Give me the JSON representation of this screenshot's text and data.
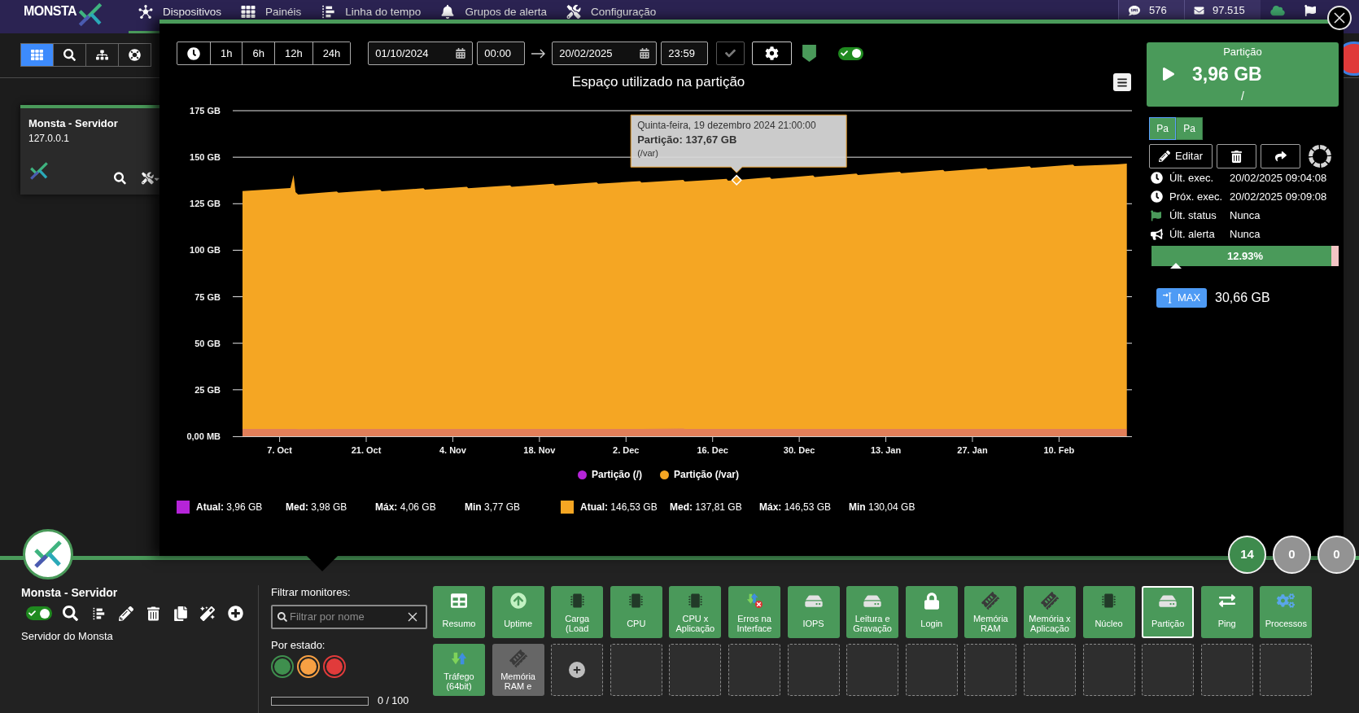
{
  "nav": {
    "logo": "MONSTA",
    "items": [
      {
        "label": "Dispositivos",
        "selected": true
      },
      {
        "label": "Painéis",
        "selected": false
      },
      {
        "label": "Linha do tempo",
        "selected": false
      },
      {
        "label": "Grupos de alerta",
        "selected": false
      },
      {
        "label": "Configuração",
        "selected": false
      }
    ],
    "counters": [
      {
        "kind": "sms",
        "value": "576"
      },
      {
        "kind": "mail",
        "value": "97.515"
      }
    ]
  },
  "view_buttons": [
    {
      "selected": true
    },
    {
      "selected": false
    },
    {
      "selected": false
    },
    {
      "selected": false
    }
  ],
  "device_card": {
    "name": "Monsta - Servidor",
    "address": "127.0.0.1"
  },
  "modal": {
    "toolbar": {
      "presets": [
        {
          "label": "1h",
          "selected": false
        },
        {
          "label": "6h",
          "selected": false
        },
        {
          "label": "12h",
          "selected": false
        },
        {
          "label": "24h",
          "selected": false
        }
      ],
      "start_date": "01/10/2024",
      "start_time": "00:00",
      "end_date": "20/02/2025",
      "end_time": "23:59",
      "apply_disabled": true,
      "live": true
    },
    "chart": {
      "chart_data": {
        "type": "area",
        "title": "Espaço utilizado na partição",
        "grid": true,
        "x": [
          "2024-10-01 00:00",
          "2024-10-08 18:00",
          "2024-10-09 06:00",
          "2024-10-09 14:00",
          "2024-10-10 00:00",
          "2024-10-16 06:00",
          "2024-10-16 12:00",
          "2024-10-23 06:00",
          "2024-10-23 12:00",
          "2024-10-30 06:00",
          "2024-10-30 12:00",
          "2024-11-06 06:00",
          "2024-11-06 12:00",
          "2024-11-13 06:00",
          "2024-11-13 12:00",
          "2024-11-20 06:00",
          "2024-11-20 12:00",
          "2024-11-27 06:00",
          "2024-11-27 12:00",
          "2024-12-04 06:00",
          "2024-12-04 12:00",
          "2024-12-11 06:00",
          "2024-12-11 12:00",
          "2024-12-18 06:00",
          "2024-12-18 12:00",
          "2024-12-19 21:00",
          "2024-12-25 06:00",
          "2024-12-25 12:00",
          "2025-01-01 06:00",
          "2025-01-01 12:00",
          "2025-01-08 06:00",
          "2025-01-08 12:00",
          "2025-01-15 06:00",
          "2025-01-15 12:00",
          "2025-01-22 06:00",
          "2025-01-22 12:00",
          "2025-01-29 06:00",
          "2025-01-29 12:00",
          "2025-02-05 06:00",
          "2025-02-05 12:00",
          "2025-02-12 06:00",
          "2025-02-12 12:00",
          "2025-02-19 06:00",
          "2025-02-20 23:00"
        ],
        "series": [
          {
            "name": "Partição (/)",
            "color": "#b524d8",
            "values": [
              3.9,
              4.0,
              4.0,
              3.9,
              3.8,
              3.9,
              3.9,
              4.0,
              4.0,
              4.0,
              4.0,
              4.0,
              4.0,
              4.0,
              4.0,
              4.0,
              4.0,
              4.0,
              4.0,
              4.0,
              4.0,
              4.1,
              4.0,
              4.0,
              4.0,
              4.0,
              4.0,
              4.0,
              4.0,
              4.0,
              4.0,
              4.0,
              4.0,
              4.0,
              4.0,
              4.0,
              4.0,
              4.0,
              4.0,
              4.0,
              4.0,
              4.0,
              4.0,
              4.0
            ]
          },
          {
            "name": "Partição (/var)",
            "color": "#f5a623",
            "values": [
              131.8,
              133.4,
              140.4,
              131.2,
              130.0,
              131.6,
              130.9,
              132.5,
              131.7,
              133.3,
              132.5,
              134.1,
              133.3,
              134.9,
              134.1,
              135.7,
              134.9,
              136.5,
              135.7,
              137.2,
              136.4,
              137.8,
              137.0,
              138.4,
              137.4,
              137.7,
              139.2,
              138.4,
              140.2,
              139.4,
              141.2,
              140.4,
              142.2,
              141.4,
              143.2,
              142.4,
              144.2,
              143.4,
              145.1,
              144.3,
              146.0,
              145.2,
              146.1,
              146.5
            ]
          }
        ],
        "xlim": [
          "2024-10-01 00:00",
          "2025-02-20 23:59"
        ],
        "ylim": [
          0,
          175
        ],
        "xticks": [
          {
            "value": "2024-10-07 00:00",
            "label": "7. Oct"
          },
          {
            "value": "2024-10-21 00:00",
            "label": "21. Oct"
          },
          {
            "value": "2024-11-04 00:00",
            "label": "4. Nov"
          },
          {
            "value": "2024-11-18 00:00",
            "label": "18. Nov"
          },
          {
            "value": "2024-12-02 00:00",
            "label": "2. Dec"
          },
          {
            "value": "2024-12-16 00:00",
            "label": "16. Dec"
          },
          {
            "value": "2024-12-30 00:00",
            "label": "30. Dec"
          },
          {
            "value": "2025-01-13 00:00",
            "label": "13. Jan"
          },
          {
            "value": "2025-01-27 00:00",
            "label": "27. Jan"
          },
          {
            "value": "2025-02-10 00:00",
            "label": "10. Feb"
          }
        ],
        "yticks": [
          {
            "value": 0,
            "label": "0,00 MB"
          },
          {
            "value": 25,
            "label": "25 GB"
          },
          {
            "value": 50,
            "label": "50 GB"
          },
          {
            "value": 75,
            "label": "75 GB"
          },
          {
            "value": 100,
            "label": "100 GB"
          },
          {
            "value": 125,
            "label": "125 GB"
          },
          {
            "value": 150,
            "label": "150 GB"
          },
          {
            "value": 175,
            "label": "175 GB"
          }
        ],
        "annotations": [
          {
            "x": "2024-12-19 21:00",
            "y": 137.7,
            "text": "Quinta-feira, 19 dezembro 2024 21:00:00\n**Partição: 137,67 GB**\n(/var)"
          }
        ]
      },
      "stats": [
        {
          "color": "#b524d8",
          "items": [
            "**Atual:** 3,96 GB",
            "**Med:** 3,98 GB",
            "**Máx:** 4,06 GB",
            "**Min** 3,77 GB"
          ]
        },
        {
          "color": "#f5a623",
          "items": [
            "**Atual:** 146,53 GB",
            "**Med:** 137,81 GB",
            "**Máx:** 146,53 GB",
            "**Min** 130,04 GB"
          ]
        }
      ]
    },
    "monitor": {
      "title": "Partição",
      "value": "3,96 GB",
      "path": "/",
      "tabs": [
        {
          "label": "Pa",
          "selected": true
        },
        {
          "label": "Pa",
          "selected": false
        }
      ],
      "edit_label": "Editar",
      "info": [
        {
          "kind": "clock",
          "label": "Últ. exec.",
          "value": "20/02/2025 09:04:08"
        },
        {
          "kind": "clock",
          "label": "Próx. exec.",
          "value": "20/02/2025 09:09:08"
        },
        {
          "kind": "status",
          "label": "Últ. status",
          "value": "Nunca"
        },
        {
          "kind": "alert",
          "label": "Últ. alerta",
          "value": "Nunca"
        }
      ],
      "usage": {
        "label": "12.93%",
        "level": 0.1293
      },
      "max": {
        "label": "MAX",
        "value": "30,66 GB"
      }
    }
  },
  "device": {
    "name": "Monsta - Servidor",
    "enabled": true,
    "description": "Servidor do Monsta"
  },
  "filter": {
    "title": "Filtrar monitores:",
    "placeholder": "Filtrar por nome",
    "state_title": "Por estado:",
    "states": [
      {
        "color": "#3f8f4e"
      },
      {
        "color": "#f7a043"
      },
      {
        "color": "#e13b3b"
      }
    ],
    "progress": {
      "level": 0,
      "label": "0 / 100"
    }
  },
  "monitors": [
    {
      "kind": "summary",
      "label": "Resumo",
      "selected": false,
      "disabled": false
    },
    {
      "kind": "uptime",
      "label": "Uptime",
      "selected": false,
      "disabled": false
    },
    {
      "kind": "chip",
      "label": "Carga (Load",
      "selected": false,
      "disabled": false
    },
    {
      "kind": "chip",
      "label": "CPU",
      "selected": false,
      "disabled": false
    },
    {
      "kind": "chip",
      "label": "CPU x Aplicação",
      "selected": false,
      "disabled": false
    },
    {
      "kind": "network",
      "label": "Erros na Interface",
      "selected": false,
      "disabled": false
    },
    {
      "kind": "disk",
      "label": "IOPS",
      "selected": false,
      "disabled": false
    },
    {
      "kind": "disk",
      "label": "Leitura e Gravação",
      "selected": false,
      "disabled": false
    },
    {
      "kind": "lock",
      "label": "Login",
      "selected": false,
      "disabled": false
    },
    {
      "kind": "memory",
      "label": "Memória RAM",
      "selected": false,
      "disabled": false
    },
    {
      "kind": "memory",
      "label": "Memória x Aplicação",
      "selected": false,
      "disabled": false
    },
    {
      "kind": "chip",
      "label": "Núcleo",
      "selected": false,
      "disabled": false
    },
    {
      "kind": "disk",
      "label": "Partição",
      "selected": true,
      "disabled": false
    },
    {
      "kind": "ping",
      "label": "Ping",
      "selected": false,
      "disabled": false
    },
    {
      "kind": "processes",
      "label": "Processos",
      "selected": false,
      "disabled": false
    },
    {
      "kind": "traffic",
      "label": "Tráfego (64bit)",
      "selected": false,
      "disabled": false
    },
    {
      "kind": "memory",
      "label": "Memória RAM e",
      "selected": false,
      "disabled": true
    },
    {
      "kind": "add"
    },
    {
      "kind": "empty"
    },
    {
      "kind": "empty"
    },
    {
      "kind": "empty"
    },
    {
      "kind": "empty"
    },
    {
      "kind": "empty"
    },
    {
      "kind": "empty"
    },
    {
      "kind": "empty"
    },
    {
      "kind": "empty"
    },
    {
      "kind": "empty"
    },
    {
      "kind": "empty"
    },
    {
      "kind": "empty"
    },
    {
      "kind": "empty"
    }
  ],
  "badges": [
    {
      "value": "14",
      "color": "#3e8b4d"
    },
    {
      "value": "0",
      "color": "#939393"
    },
    {
      "value": "0",
      "color": "#939393"
    }
  ]
}
